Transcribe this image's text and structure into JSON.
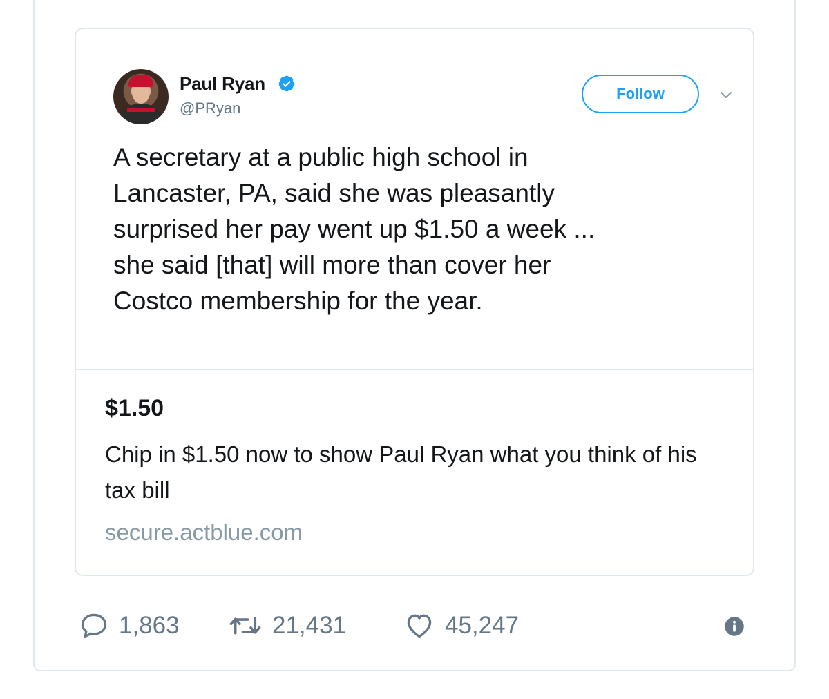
{
  "tweet": {
    "author": {
      "name": "Paul Ryan",
      "handle": "@PRyan",
      "verified": true
    },
    "follow_label": "Follow",
    "text": "A secretary at a public high school in\nLancaster, PA, said she was pleasantly\nsurprised her pay went up $1.50 a week ...\nshe said [that] will more than cover her\nCostco membership for the year."
  },
  "card": {
    "title": "$1.50",
    "description": "Chip in $1.50 now to show Paul Ryan what you think of his tax bill",
    "domain": "secure.actblue.com"
  },
  "actions": {
    "replies": "1,863",
    "retweets": "21,431",
    "likes": "45,247"
  },
  "colors": {
    "accent": "#1da1f2",
    "muted": "#657786",
    "border": "#e1e8ed"
  },
  "icons": {
    "verified": "verified-badge-icon",
    "menu": "chevron-down-icon",
    "reply": "speech-bubble-icon",
    "retweet": "retweet-icon",
    "like": "heart-icon",
    "info": "info-icon"
  }
}
